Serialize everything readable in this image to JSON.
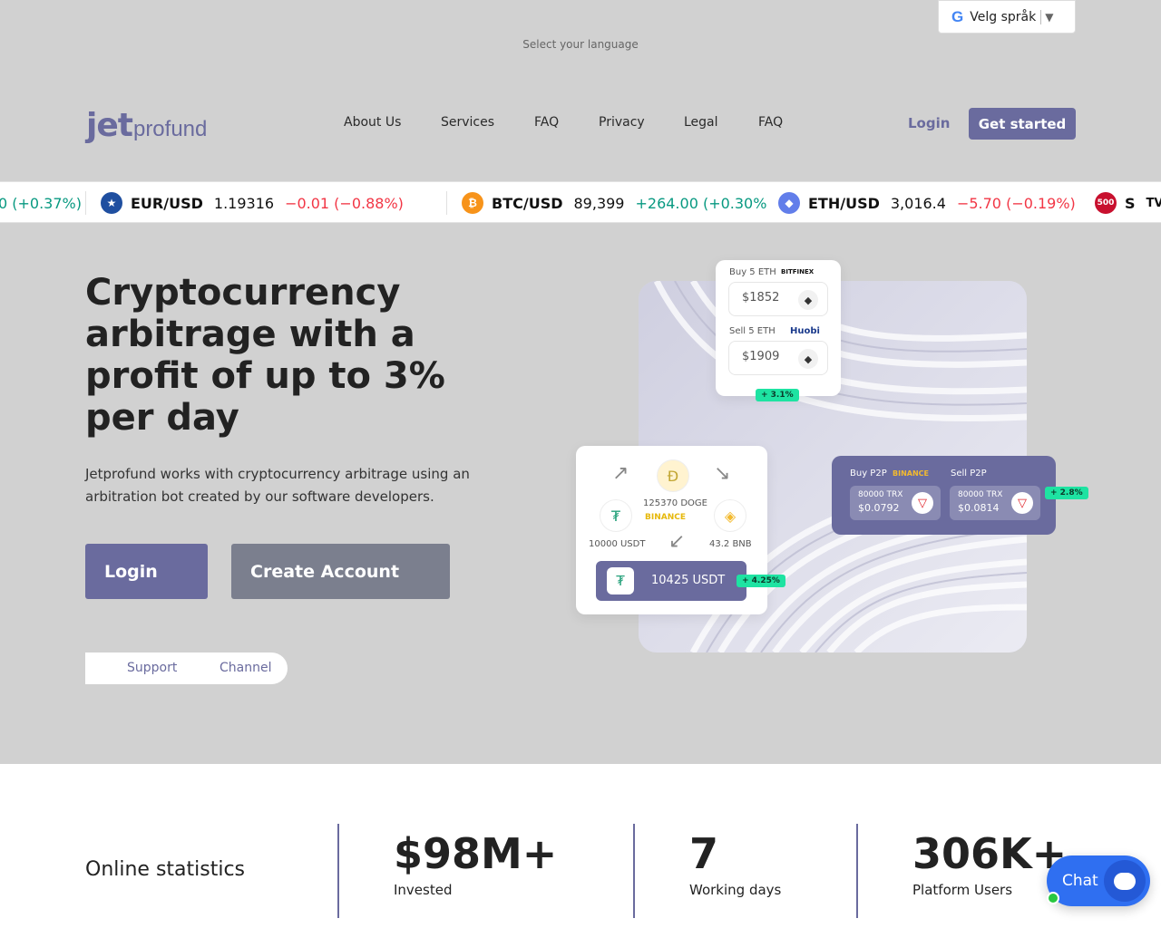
{
  "language": {
    "selector_label": "Velg språk",
    "hint": "Select your language"
  },
  "header": {
    "logo_main": "jet",
    "logo_sub": "profund",
    "nav": [
      "About Us",
      "Services",
      "FAQ",
      "Privacy",
      "Legal",
      "FAQ"
    ],
    "login": "Login",
    "get_started": "Get started"
  },
  "ticker": [
    {
      "symbol": "",
      "price": "",
      "change": "0 (+0.37%)",
      "dir": "up"
    },
    {
      "symbol": "EUR/USD",
      "price": "1.19316",
      "change": "−0.01 (−0.88%)",
      "dir": "down",
      "icon": "eu-us-flag-icon"
    },
    {
      "symbol": "BTC/USD",
      "price": "89,399",
      "change": "+264.00 (+0.30%",
      "dir": "up",
      "icon": "bitcoin-icon"
    },
    {
      "symbol": "ETH/USD",
      "price": "3,016.4",
      "change": "−5.70 (−0.19%)",
      "dir": "down",
      "icon": "ethereum-icon"
    },
    {
      "symbol": "S",
      "badge": "500",
      "icon": "sp500-icon"
    }
  ],
  "hero": {
    "title": "Cryptocurrency arbitrage with a profit of up to 3% per day",
    "text": "Jetprofund works with cryptocurrency arbitrage using an arbitration bot created by our software developers.",
    "login_button": "Login",
    "create_button": "Create Account",
    "toggle": [
      "Support",
      "Channel"
    ]
  },
  "illustration": {
    "buy_label": "Buy 5 ETH",
    "buy_exchange": "BITFINEX",
    "buy_price": "$1852",
    "sell_label": "Sell 5 ETH",
    "sell_exchange": "Huobi",
    "sell_price": "$1909",
    "spread": "+ 3.1%",
    "doge_amount": "125370 DOGE",
    "doge_exchange": "BINANCE",
    "usdt_amount": "10000 USDT",
    "bnb_amount": "43.2 BNB",
    "result": "10425 USDT",
    "result_gain": "+ 4.25%",
    "p2p_buy": "Buy P2P",
    "p2p_exchange": "BINANCE",
    "p2p_sell": "Sell P2P",
    "p2p_buy_amount": "80000 TRX",
    "p2p_buy_price": "$0.0792",
    "p2p_sell_amount": "80000 TRX",
    "p2p_sell_price": "$0.0814",
    "p2p_gain": "+ 2.8%"
  },
  "stats": {
    "label": "Online statistics",
    "items": [
      {
        "value": "$98M+",
        "caption": "Invested"
      },
      {
        "value": "7",
        "caption": "Working days"
      },
      {
        "value": "306K+",
        "caption": "Platform Users"
      }
    ]
  },
  "chat": {
    "label": "Chat"
  },
  "colors": {
    "accent": "#6a6b9e",
    "up": "#089981",
    "down": "#f23645",
    "chat": "#2f6ff1"
  }
}
